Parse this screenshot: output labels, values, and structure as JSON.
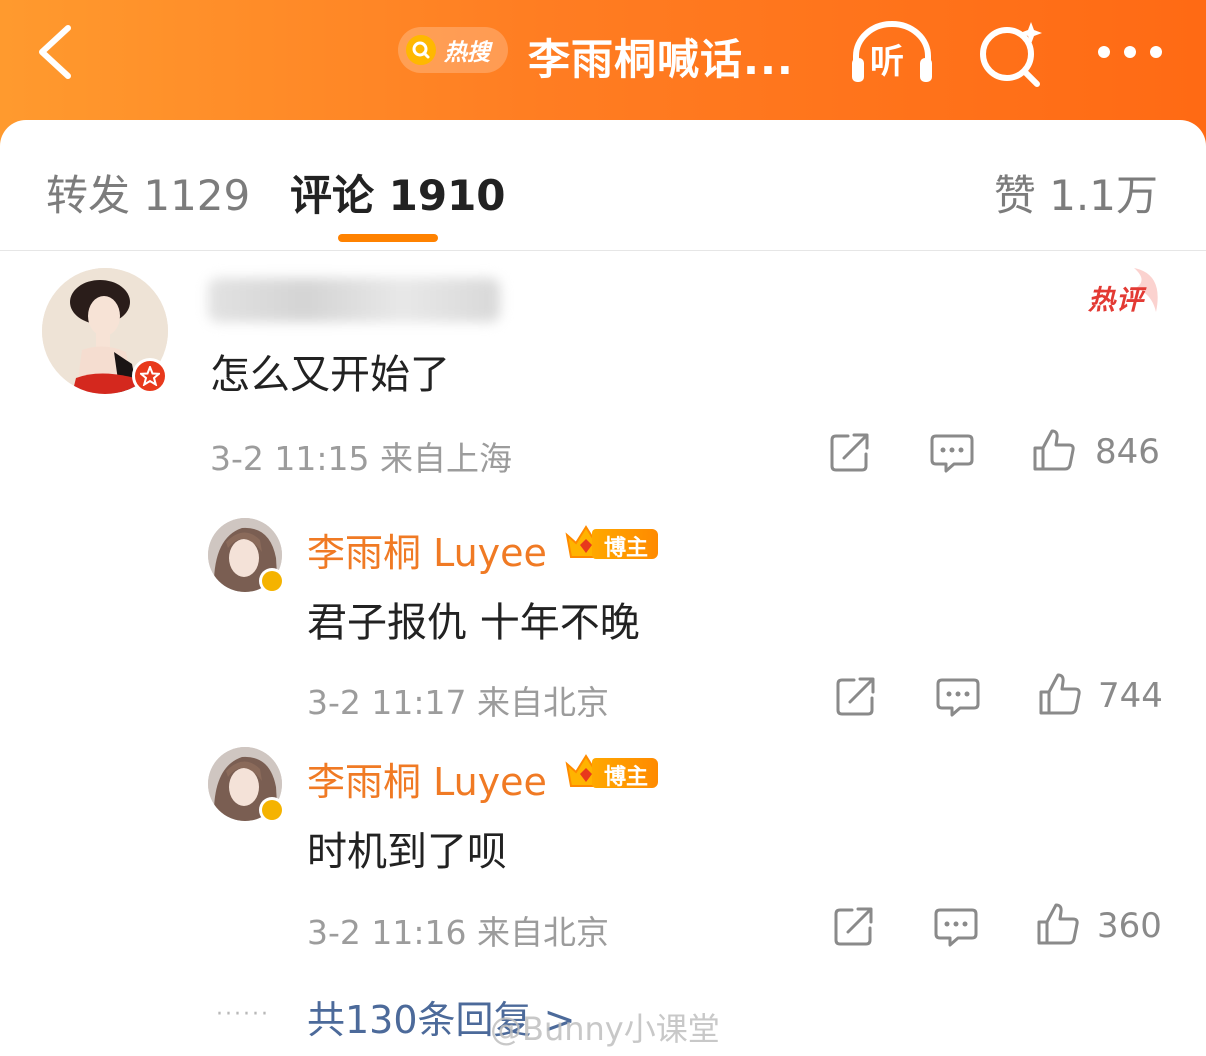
{
  "header": {
    "hot_label": "热搜",
    "title": "李雨桐喊话...",
    "listen_label": "听"
  },
  "tabs": {
    "repost": "转发 1129",
    "comment": "评论 1910",
    "like": "赞 1.1万"
  },
  "main_comment": {
    "hot_tag": "热评",
    "text": "怎么又开始了",
    "meta": "3-2 11:15 来自上海",
    "likes": "846"
  },
  "replies": [
    {
      "name": "李雨桐 Luyee",
      "badge": "博主",
      "text": "君子报仇 十年不晚",
      "meta": "3-2 11:17 来自北京",
      "likes": "744"
    },
    {
      "name": "李雨桐 Luyee",
      "badge": "博主",
      "text": "时机到了呗",
      "meta": "3-2 11:16 来自北京",
      "likes": "360"
    }
  ],
  "more_replies": "共130条回复 >",
  "watermark": "@Bunny小课堂",
  "colors": {
    "brand_orange": "#ff7d22",
    "accent": "#ff8200",
    "name_orange": "#f07a24",
    "link_blue": "#4c6a9a"
  }
}
